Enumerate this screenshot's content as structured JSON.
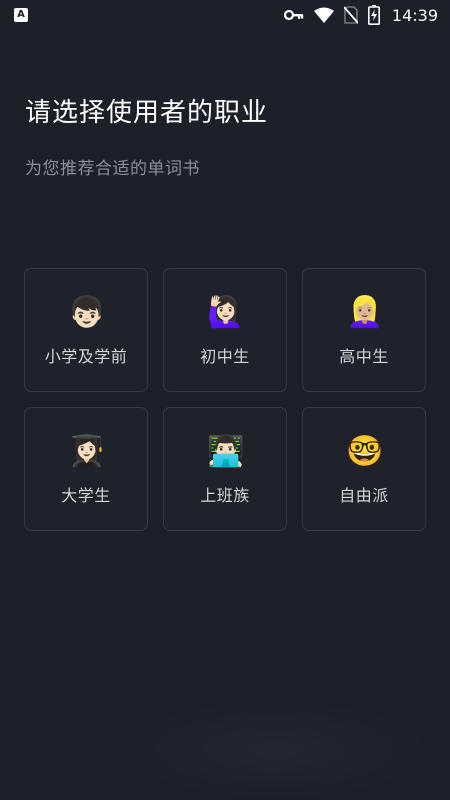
{
  "status_bar": {
    "time": "14:39",
    "app_icon_letter": "A",
    "icons": [
      "key-icon",
      "wifi-icon",
      "no-sim-icon",
      "battery-charging-icon"
    ]
  },
  "header": {
    "title": "请选择使用者的职业",
    "subtitle": "为您推荐合适的单词书"
  },
  "occupations": [
    {
      "label": "小学及学前",
      "icon": "boy-icon",
      "emoji": "👦🏻"
    },
    {
      "label": "初中生",
      "icon": "woman-raising-hand-icon",
      "emoji": "🙋🏻‍♀️"
    },
    {
      "label": "高中生",
      "icon": "blonde-girl-icon",
      "emoji": "👱🏼‍♀️"
    },
    {
      "label": "大学生",
      "icon": "student-icon",
      "emoji": "👩🏻‍🎓"
    },
    {
      "label": "上班族",
      "icon": "technologist-icon",
      "emoji": "👨🏻‍💻"
    },
    {
      "label": "自由派",
      "icon": "nerd-face-icon",
      "emoji": "🤓"
    }
  ],
  "colors": {
    "background": "#1d1f29",
    "card_border": "#353846",
    "title": "#ffffff",
    "subtitle": "#8b8e98"
  }
}
